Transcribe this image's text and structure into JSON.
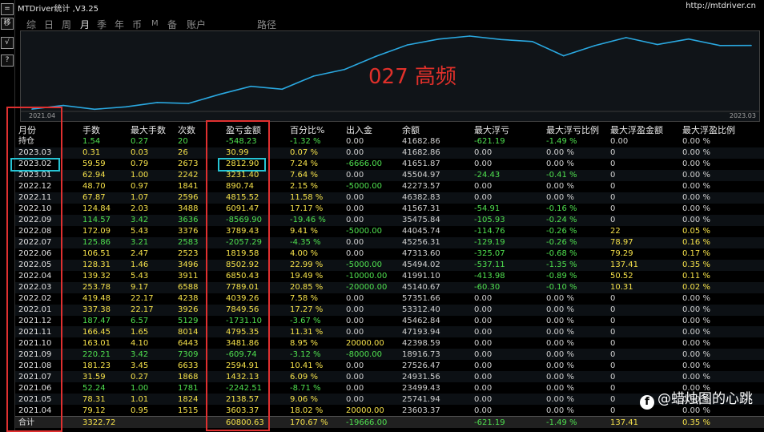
{
  "window": {
    "title": "MTDriver统计 ,V3.25",
    "url": "http://mtdriver.cn"
  },
  "sidebar_buttons": [
    "=",
    "移",
    "√",
    "?"
  ],
  "tabs": [
    {
      "label": "综",
      "active": false
    },
    {
      "label": "日",
      "active": false
    },
    {
      "label": "周",
      "active": false
    },
    {
      "label": "月",
      "active": true
    },
    {
      "label": "季",
      "active": false
    },
    {
      "label": "年",
      "active": false
    },
    {
      "label": "币",
      "active": false
    },
    {
      "label": "M",
      "active": false
    },
    {
      "label": "备",
      "active": false
    },
    {
      "label": "账户",
      "active": false
    },
    {
      "label": "路径",
      "active": false
    }
  ],
  "chart_data": {
    "type": "line",
    "title": "",
    "annotation": "027  高频",
    "x_start_label": "2021.04",
    "x_end_label": "2023.03",
    "x": [
      "2021.04",
      "2021.05",
      "2021.06",
      "2021.07",
      "2021.08",
      "2021.09",
      "2021.10",
      "2021.11",
      "2021.12",
      "2022.01",
      "2022.02",
      "2022.03",
      "2022.04",
      "2022.05",
      "2022.06",
      "2022.07",
      "2022.08",
      "2022.09",
      "2022.10",
      "2022.11",
      "2022.12",
      "2023.01",
      "2023.02",
      "2023.03"
    ],
    "series": [
      {
        "values": [
          3603.37,
          5741.94,
          3499.43,
          4931.56,
          7526.47,
          6916.73,
          12398.59,
          17193.94,
          15462.84,
          23312.4,
          27351.66,
          35140.67,
          41991.1,
          45494.02,
          47313.6,
          45256.31,
          44045.74,
          35475.84,
          41567.31,
          46382.83,
          42273.57,
          45504.97,
          41651.87,
          41682.86
        ]
      }
    ],
    "line_color": "#2aa8e0",
    "grid": false
  },
  "table": {
    "headers": [
      "月份",
      "手数",
      "最大手数",
      "次数",
      "盈亏金额",
      "百分比%",
      "出入金",
      "余额",
      "最大浮亏",
      "最大浮亏比例",
      "最大浮盈金额",
      "最大浮盈比例"
    ],
    "rows": [
      [
        "持仓",
        "1.54",
        "0.27",
        "20",
        "-548.23",
        "-1.32 %",
        "0.00",
        "41682.86",
        "-621.19",
        "-1.49 %",
        "0.00",
        "0.00 %"
      ],
      [
        "2023.03",
        "0.31",
        "0.03",
        "26",
        "30.99",
        "0.07 %",
        "0.00",
        "41682.86",
        "0.00",
        "0.00 %",
        "0",
        "0.00 %"
      ],
      [
        "2023.02",
        "59.59",
        "0.79",
        "2673",
        "2812.90",
        "7.24 %",
        "-6666.00",
        "41651.87",
        "0.00",
        "0.00 %",
        "0",
        "0.00 %"
      ],
      [
        "2023.01",
        "62.94",
        "1.00",
        "2242",
        "3231.40",
        "7.64 %",
        "0.00",
        "45504.97",
        "-24.43",
        "-0.41 %",
        "0",
        "0.00 %"
      ],
      [
        "2022.12",
        "48.70",
        "0.97",
        "1841",
        "890.74",
        "2.15 %",
        "-5000.00",
        "42273.57",
        "0.00",
        "0.00 %",
        "0",
        "0.00 %"
      ],
      [
        "2022.11",
        "67.87",
        "1.07",
        "2596",
        "4815.52",
        "11.58 %",
        "0.00",
        "46382.83",
        "0.00",
        "0.00 %",
        "0",
        "0.00 %"
      ],
      [
        "2022.10",
        "124.84",
        "2.03",
        "3488",
        "6091.47",
        "17.17 %",
        "0.00",
        "41567.31",
        "-54.91",
        "-0.16 %",
        "0",
        "0.00 %"
      ],
      [
        "2022.09",
        "114.57",
        "3.42",
        "3636",
        "-8569.90",
        "-19.46 %",
        "0.00",
        "35475.84",
        "-105.93",
        "-0.24 %",
        "0",
        "0.00 %"
      ],
      [
        "2022.08",
        "172.09",
        "5.43",
        "3376",
        "3789.43",
        "9.41 %",
        "-5000.00",
        "44045.74",
        "-114.76",
        "-0.26 %",
        "22",
        "0.05 %"
      ],
      [
        "2022.07",
        "125.86",
        "3.21",
        "2583",
        "-2057.29",
        "-4.35 %",
        "0.00",
        "45256.31",
        "-129.19",
        "-0.26 %",
        "78.97",
        "0.16 %"
      ],
      [
        "2022.06",
        "106.51",
        "2.47",
        "2523",
        "1819.58",
        "4.00 %",
        "0.00",
        "47313.60",
        "-325.07",
        "-0.68 %",
        "79.29",
        "0.17 %"
      ],
      [
        "2022.05",
        "128.31",
        "1.46",
        "3496",
        "8502.92",
        "22.99 %",
        "-5000.00",
        "45494.02",
        "-537.11",
        "-1.35 %",
        "137.41",
        "0.35 %"
      ],
      [
        "2022.04",
        "139.32",
        "5.43",
        "3911",
        "6850.43",
        "19.49 %",
        "-10000.00",
        "41991.10",
        "-413.98",
        "-0.89 %",
        "50.52",
        "0.11 %"
      ],
      [
        "2022.03",
        "253.78",
        "9.17",
        "6588",
        "7789.01",
        "20.85 %",
        "-20000.00",
        "45140.67",
        "-60.30",
        "-0.10 %",
        "10.31",
        "0.02 %"
      ],
      [
        "2022.02",
        "419.48",
        "22.17",
        "4238",
        "4039.26",
        "7.58 %",
        "0.00",
        "57351.66",
        "0.00",
        "0.00 %",
        "0",
        "0.00 %"
      ],
      [
        "2022.01",
        "337.38",
        "22.17",
        "3926",
        "7849.56",
        "17.27 %",
        "0.00",
        "53312.40",
        "0.00",
        "0.00 %",
        "0",
        "0.00 %"
      ],
      [
        "2021.12",
        "187.47",
        "6.57",
        "5129",
        "-1731.10",
        "-3.67 %",
        "0.00",
        "45462.84",
        "0.00",
        "0.00 %",
        "0",
        "0.00 %"
      ],
      [
        "2021.11",
        "166.45",
        "1.65",
        "8014",
        "4795.35",
        "11.31 %",
        "0.00",
        "47193.94",
        "0.00",
        "0.00 %",
        "0",
        "0.00 %"
      ],
      [
        "2021.10",
        "163.01",
        "4.10",
        "6443",
        "3481.86",
        "8.95 %",
        "20000.00",
        "42398.59",
        "0.00",
        "0.00 %",
        "0",
        "0.00 %"
      ],
      [
        "2021.09",
        "220.21",
        "3.42",
        "7309",
        "-609.74",
        "-3.12 %",
        "-8000.00",
        "18916.73",
        "0.00",
        "0.00 %",
        "0",
        "0.00 %"
      ],
      [
        "2021.08",
        "181.23",
        "3.45",
        "6633",
        "2594.91",
        "10.41 %",
        "0.00",
        "27526.47",
        "0.00",
        "0.00 %",
        "0",
        "0.00 %"
      ],
      [
        "2021.07",
        "31.59",
        "0.27",
        "1868",
        "1432.13",
        "6.09 %",
        "0.00",
        "24931.56",
        "0.00",
        "0.00 %",
        "0",
        "0.00 %"
      ],
      [
        "2021.06",
        "52.24",
        "1.00",
        "1781",
        "-2242.51",
        "-8.71 %",
        "0.00",
        "23499.43",
        "0.00",
        "0.00 %",
        "0",
        "0.00 %"
      ],
      [
        "2021.05",
        "78.31",
        "1.01",
        "1824",
        "2138.57",
        "9.06 %",
        "0.00",
        "25741.94",
        "0.00",
        "0.00 %",
        "0",
        "0.00 %"
      ],
      [
        "2021.04",
        "79.12",
        "0.95",
        "1515",
        "3603.37",
        "18.02 %",
        "20000.00",
        "23603.37",
        "0.00",
        "0.00 %",
        "0",
        "0.00 %"
      ]
    ],
    "total": [
      "合计",
      "3322.72",
      "",
      "",
      "60800.63",
      "170.67 %",
      "-19666.00",
      "",
      "-621.19",
      "-1.49 %",
      "137.41",
      "0.35 %"
    ]
  },
  "highlighted_row_label": "2023.02",
  "watermark": {
    "icon": "f",
    "text": "@蜡烛图的心跳"
  },
  "colors": {
    "positive": "#f5e14a",
    "negative": "#4fe04f",
    "annotation_box": "#e03030",
    "highlight_box": "#26c4d4"
  }
}
